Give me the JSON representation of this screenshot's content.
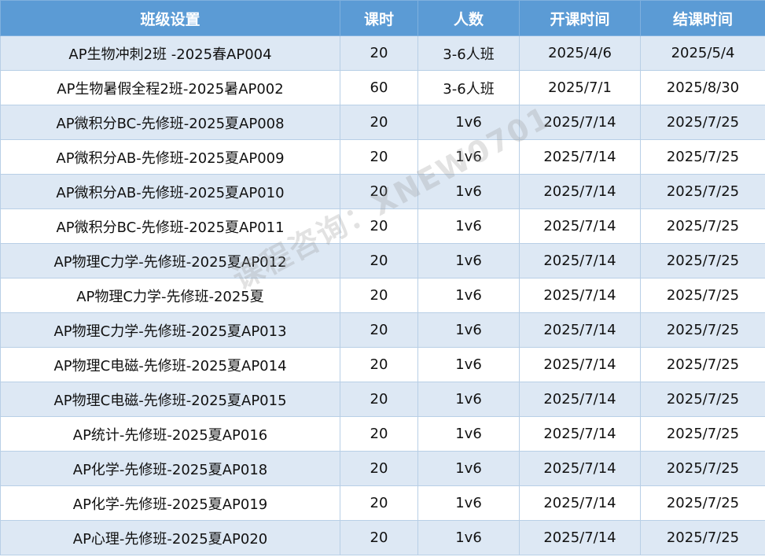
{
  "table": {
    "headers": [
      "班级设置",
      "课时",
      "人数",
      "开课时间",
      "结课时间"
    ],
    "rows": [
      [
        "AP生物冲刺2班 -2025春AP004",
        "20",
        "3-6人班",
        "2025/4/6",
        "2025/5/4"
      ],
      [
        "AP生物暑假全程2班-2025暑AP002",
        "60",
        "3-6人班",
        "2025/7/1",
        "2025/8/30"
      ],
      [
        "AP微积分BC-先修班-2025夏AP008",
        "20",
        "1v6",
        "2025/7/14",
        "2025/7/25"
      ],
      [
        "AP微积分AB-先修班-2025夏AP009",
        "20",
        "1v6",
        "2025/7/14",
        "2025/7/25"
      ],
      [
        "AP微积分AB-先修班-2025夏AP010",
        "20",
        "1v6",
        "2025/7/14",
        "2025/7/25"
      ],
      [
        "AP微积分BC-先修班-2025夏AP011",
        "20",
        "1v6",
        "2025/7/14",
        "2025/7/25"
      ],
      [
        "AP物理C力学-先修班-2025夏AP012",
        "20",
        "1v6",
        "2025/7/14",
        "2025/7/25"
      ],
      [
        "AP物理C力学-先修班-2025夏",
        "20",
        "1v6",
        "2025/7/14",
        "2025/7/25"
      ],
      [
        "AP物理C力学-先修班-2025夏AP013",
        "20",
        "1v6",
        "2025/7/14",
        "2025/7/25"
      ],
      [
        "AP物理C电磁-先修班-2025夏AP014",
        "20",
        "1v6",
        "2025/7/14",
        "2025/7/25"
      ],
      [
        "AP物理C电磁-先修班-2025夏AP015",
        "20",
        "1v6",
        "2025/7/14",
        "2025/7/25"
      ],
      [
        "AP统计-先修班-2025夏AP016",
        "20",
        "1v6",
        "2025/7/14",
        "2025/7/25"
      ],
      [
        "AP化学-先修班-2025夏AP018",
        "20",
        "1v6",
        "2025/7/14",
        "2025/7/25"
      ],
      [
        "AP化学-先修班-2025夏AP019",
        "20",
        "1v6",
        "2025/7/14",
        "2025/7/25"
      ],
      [
        "AP心理-先修班-2025夏AP020",
        "20",
        "1v6",
        "2025/7/14",
        "2025/7/25"
      ]
    ]
  },
  "watermark": "课程咨询：XNEW0701",
  "colors": {
    "header_bg": "#5b9bd5",
    "header_text": "#ffffff",
    "row_shade": "#dde8f4",
    "row_plain": "#ffffff",
    "grid": "#b8cfe6"
  }
}
